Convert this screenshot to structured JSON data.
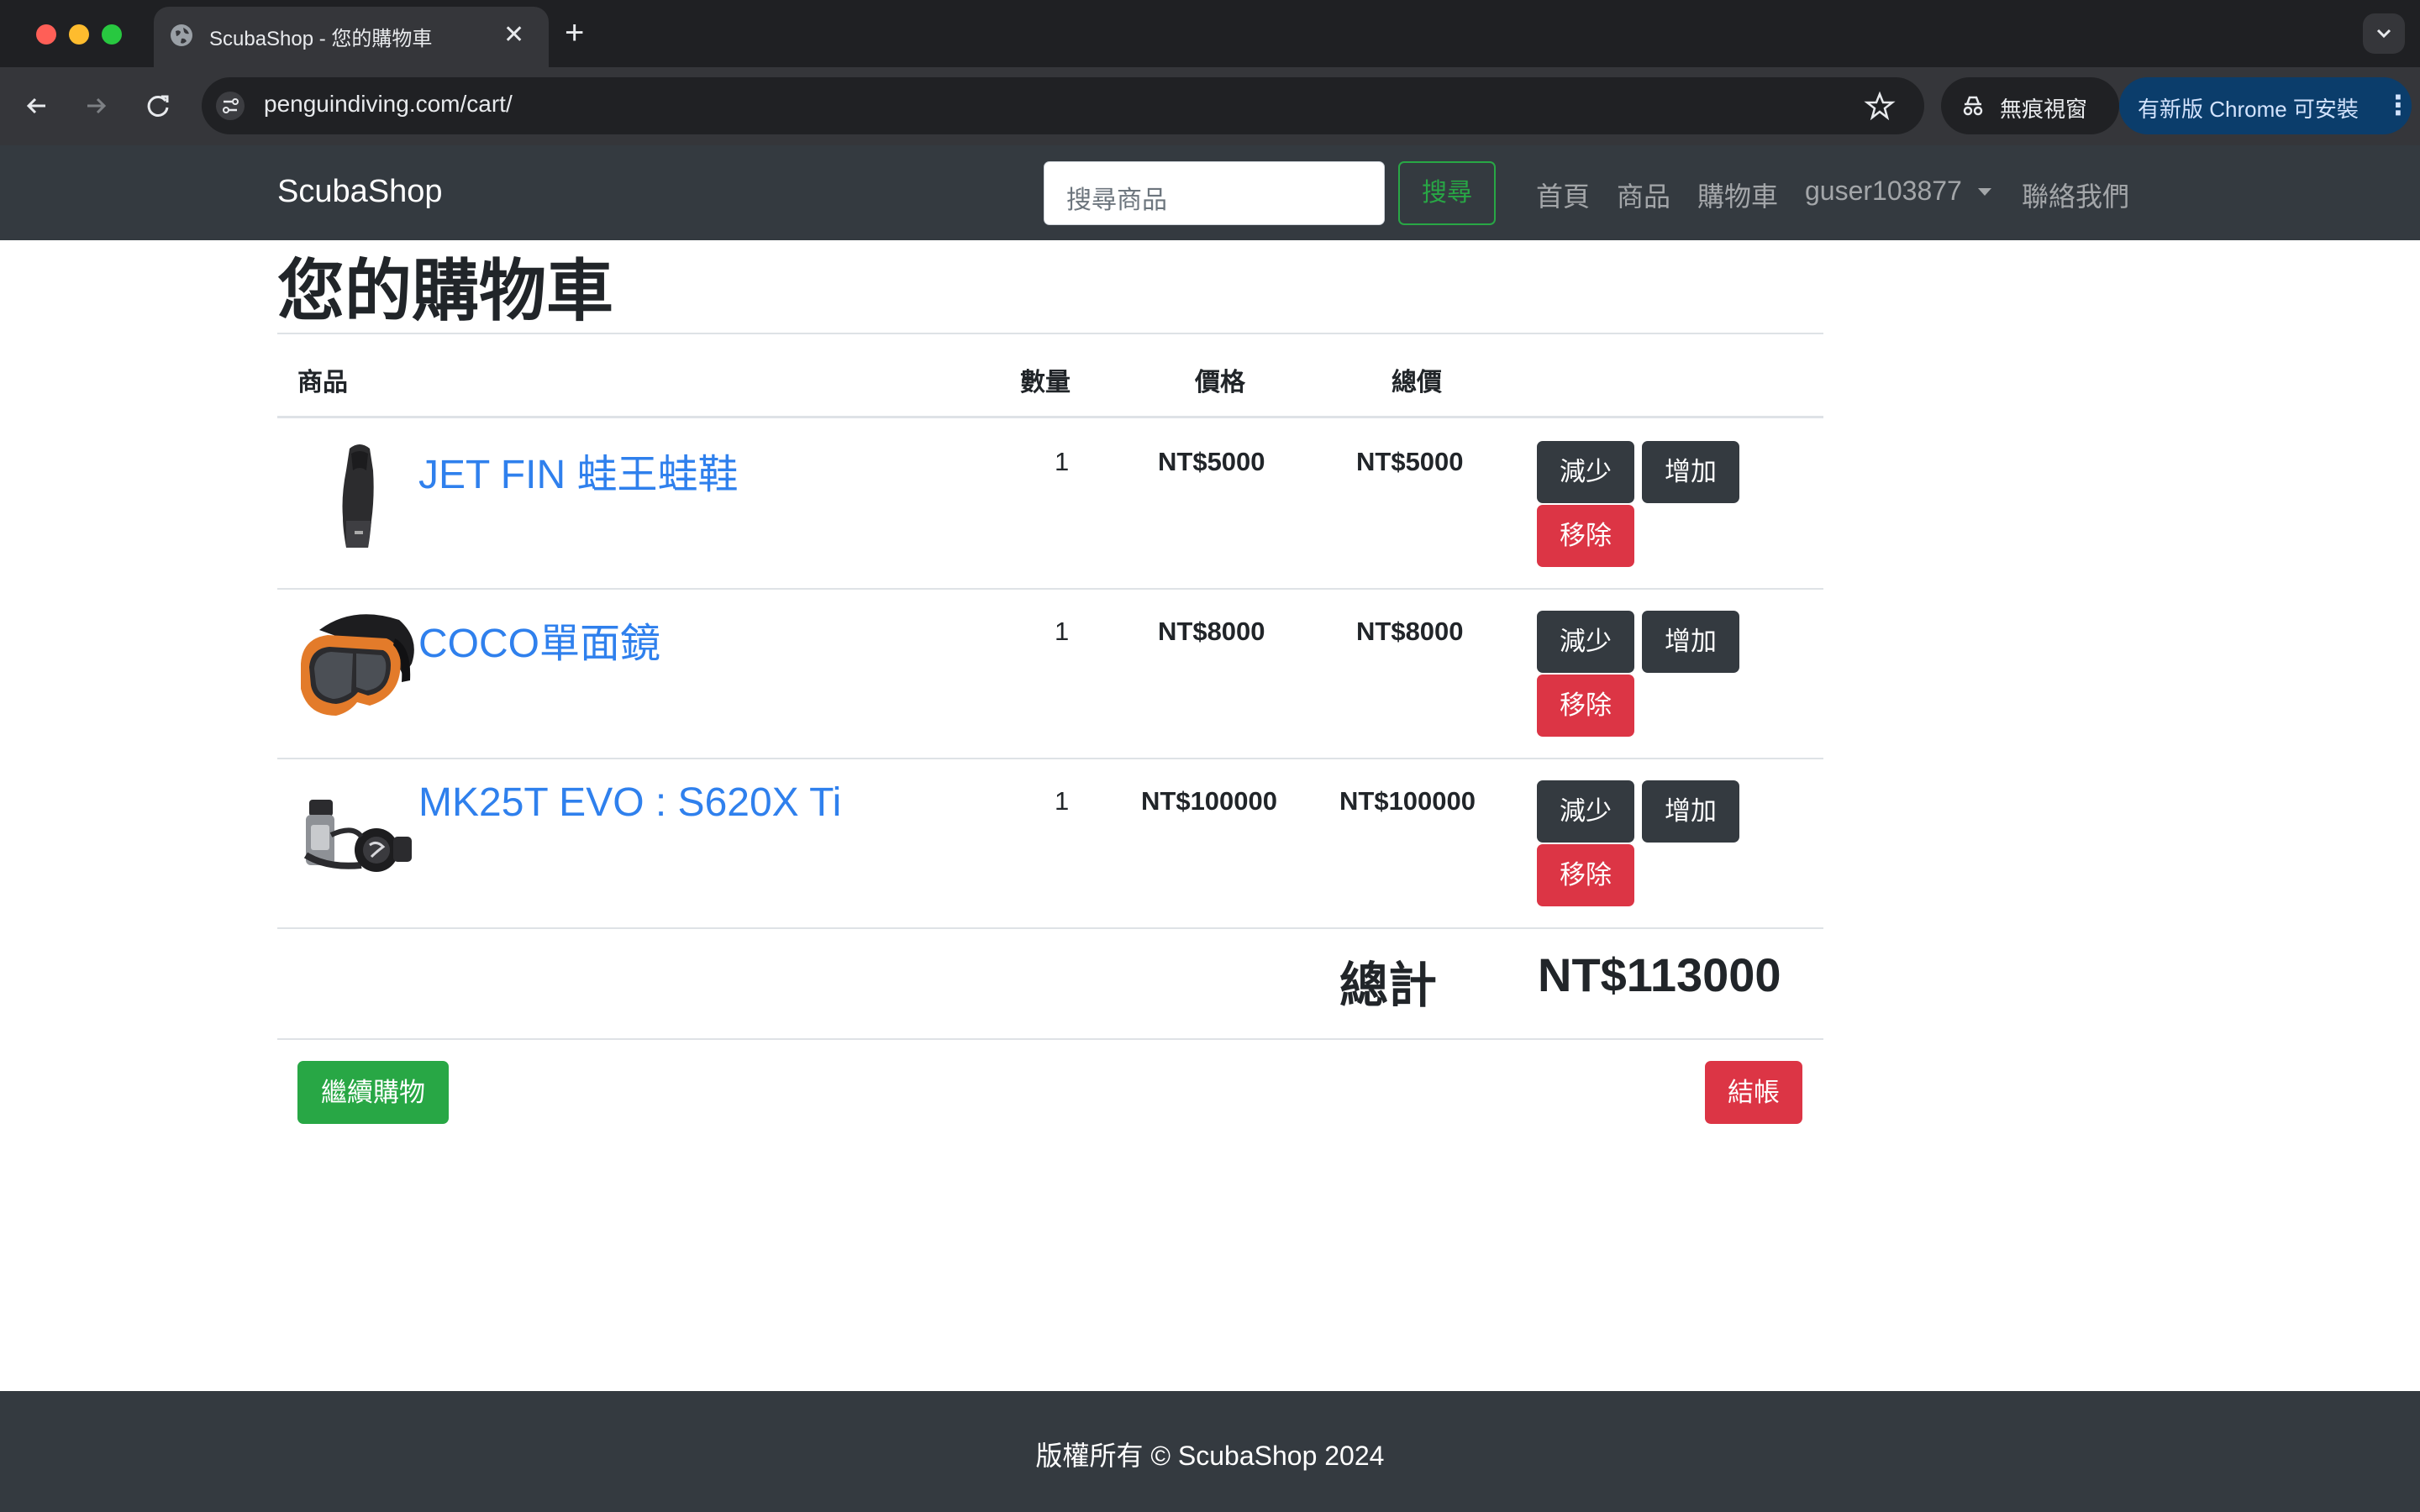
{
  "browser": {
    "tab_title": "ScubaShop - 您的購物車",
    "url": "penguindiving.com/cart/",
    "incognito_label": "無痕視窗",
    "update_label": "有新版 Chrome 可安裝",
    "icons": [
      "back-arrow-icon",
      "forward-arrow-icon",
      "reload-icon",
      "site-info-icon",
      "star-icon",
      "incognito-icon",
      "more-vert-icon",
      "globe-icon",
      "close-icon",
      "plus-icon",
      "chevron-down-icon"
    ]
  },
  "navbar": {
    "brand": "ScubaShop",
    "search_placeholder": "搜尋商品",
    "search_button": "搜尋",
    "links": [
      "首頁",
      "商品",
      "購物車"
    ],
    "user": "guser103877",
    "contact": "聯絡我們"
  },
  "page": {
    "title": "您的購物車"
  },
  "table": {
    "headers": {
      "product": "商品",
      "quantity": "數量",
      "price": "價格",
      "subtotal": "總價"
    },
    "rows": [
      {
        "name": "JET FIN 蛙王蛙鞋",
        "quantity": "1",
        "price": "NT$5000",
        "subtotal": "NT$5000",
        "image": "fin-image"
      },
      {
        "name": "COCO單面鏡",
        "quantity": "1",
        "price": "NT$8000",
        "subtotal": "NT$8000",
        "image": "mask-image"
      },
      {
        "name": "MK25T EVO : S620X Ti",
        "quantity": "1",
        "price": "NT$100000",
        "subtotal": "NT$100000",
        "image": "regulator-image"
      }
    ],
    "actions": {
      "decrease": "減少",
      "increase": "增加",
      "remove": "移除"
    },
    "total_label": "總計",
    "total_value": "NT$113000"
  },
  "buttons": {
    "continue_shopping": "繼續購物",
    "checkout": "結帳"
  },
  "footer": {
    "text": "版權所有 © ScubaShop 2024"
  },
  "colors": {
    "navbar_bg": "#343a40",
    "link_blue": "#2f80ed",
    "success_green": "#28a745",
    "danger_red": "#dc3545",
    "dark_button": "#343a40"
  }
}
